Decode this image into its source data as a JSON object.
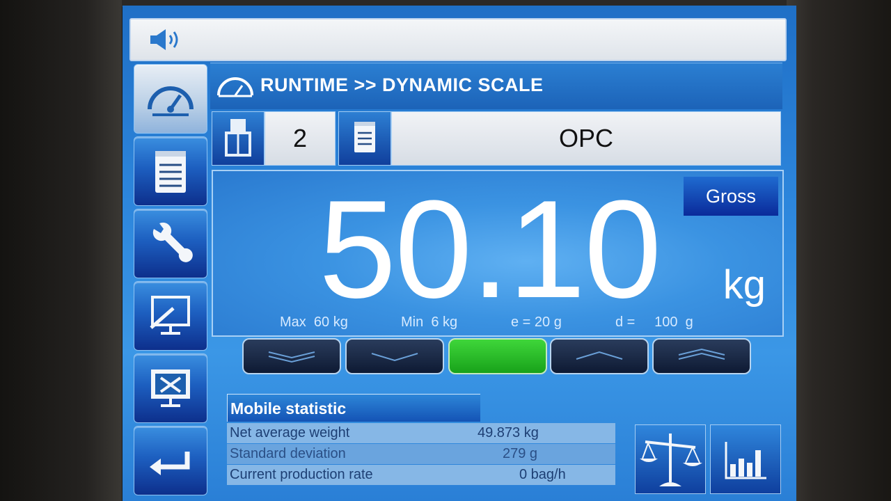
{
  "header": {
    "title": "RUNTIME >> DYNAMIC SCALE",
    "icon": "speedometer-icon"
  },
  "topbar": {
    "icon": "speaker-icon"
  },
  "sidebar": {
    "items": [
      {
        "name": "runtime",
        "icon": "speedometer-icon",
        "active": true
      },
      {
        "name": "recipes",
        "icon": "notepad-icon",
        "active": false
      },
      {
        "name": "settings",
        "icon": "wrench-icon",
        "active": false
      },
      {
        "name": "display",
        "icon": "display-tool-icon",
        "active": false
      },
      {
        "name": "service",
        "icon": "monitor-tools-icon",
        "active": false
      },
      {
        "name": "back",
        "icon": "return-arrow-icon",
        "active": false
      }
    ]
  },
  "selectors": {
    "spout": {
      "icon": "bag-filler-icon",
      "value": "2"
    },
    "product": {
      "icon": "notepad-icon",
      "value": "OPC"
    }
  },
  "display": {
    "mode": "Gross",
    "weight": "50.10",
    "unit": "kg",
    "max": "Max  60 kg",
    "min": "Min  6 kg",
    "e": "e = 20 g",
    "d": "d =     100  g"
  },
  "tolerance": {
    "buttons": [
      {
        "name": "far-under",
        "icon": "double-chevron-down-icon"
      },
      {
        "name": "under",
        "icon": "chevron-down-icon"
      },
      {
        "name": "in-tolerance",
        "icon": "ok-indicator",
        "active": true
      },
      {
        "name": "over",
        "icon": "chevron-up-icon"
      },
      {
        "name": "far-over",
        "icon": "double-chevron-up-icon"
      }
    ]
  },
  "statistics": {
    "title": "Mobile statistic",
    "rows": [
      {
        "label": "Net average weight",
        "value": "49.873 kg"
      },
      {
        "label": "Standard deviation",
        "value": "279 g"
      },
      {
        "label": "Current production rate",
        "value": "0 bag/h"
      }
    ]
  },
  "actions": [
    {
      "name": "balance",
      "icon": "balance-scale-icon"
    },
    {
      "name": "chart",
      "icon": "bar-chart-icon"
    }
  ],
  "colors": {
    "accent": "#1c63b8",
    "ok": "#2fc42b",
    "badge": "#0a2a9a"
  }
}
